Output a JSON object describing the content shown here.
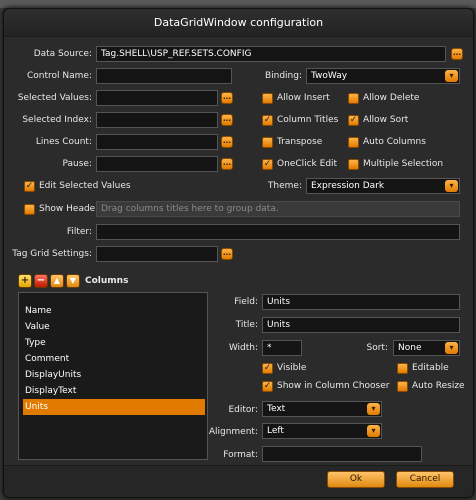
{
  "window": {
    "title": "DataGridWindow configuration"
  },
  "fields": {
    "data_source": {
      "label": "Data Source:",
      "value": "Tag.SHELL\\USP_REF.SETS.CONFIG"
    },
    "control_name": {
      "label": "Control Name:",
      "value": ""
    },
    "binding": {
      "label": "Binding:",
      "value": "TwoWay"
    },
    "selected_values": {
      "label": "Selected Values:",
      "value": ""
    },
    "selected_index": {
      "label": "Selected Index:",
      "value": ""
    },
    "lines_count": {
      "label": "Lines Count:",
      "value": ""
    },
    "pause": {
      "label": "Pause:",
      "value": ""
    },
    "theme": {
      "label": "Theme:",
      "value": "Expression Dark"
    },
    "filter": {
      "label": "Filter:",
      "value": ""
    },
    "tag_grid_settings": {
      "label": "Tag Grid Settings:",
      "value": ""
    },
    "header_placeholder": "Drag columns titles here to group data."
  },
  "checks": {
    "allow_insert": "Allow Insert",
    "allow_delete": "Allow Delete",
    "column_titles": "Column Titles",
    "allow_sort": "Allow Sort",
    "transpose": "Transpose",
    "auto_columns": "Auto Columns",
    "oneclick_edit": "OneClick Edit",
    "multiple_selection": "Multiple Selection",
    "edit_selected_values": "Edit Selected Values",
    "show_header": "Show Header:"
  },
  "columns": {
    "title": "Columns",
    "items": [
      "Name",
      "Value",
      "Type",
      "Comment",
      "DisplayUnits",
      "DisplayText",
      "Units"
    ],
    "selected": "Units"
  },
  "detail": {
    "field": {
      "label": "Field:",
      "value": "Units"
    },
    "title": {
      "label": "Title:",
      "value": "Units"
    },
    "width": {
      "label": "Width:",
      "value": "*"
    },
    "sort": {
      "label": "Sort:",
      "value": "None"
    },
    "visible": "Visible",
    "editable": "Editable",
    "show_in_chooser": "Show in Column Chooser",
    "auto_resize": "Auto Resize",
    "editor": {
      "label": "Editor:",
      "value": "Text"
    },
    "alignment": {
      "label": "Alignment:",
      "value": "Left"
    },
    "format": {
      "label": "Format:",
      "value": ""
    }
  },
  "buttons": {
    "ok": "Ok",
    "cancel": "Cancel"
  },
  "icons": {
    "dots": "…",
    "check": "✓",
    "arrow": "▾",
    "add": "+",
    "remove": "−",
    "up": "▲",
    "down": "▼"
  }
}
